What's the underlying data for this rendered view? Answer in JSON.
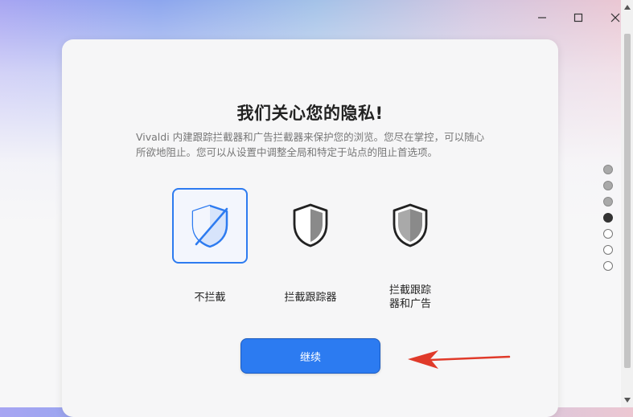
{
  "window_controls": {
    "minimize_icon": "minimize-icon",
    "maximize_icon": "maximize-icon",
    "close_icon": "close-icon"
  },
  "dialog": {
    "title": "我们关心您的隐私!",
    "description": "Vivaldi 内建跟踪拦截器和广告拦截器来保护您的浏览。您尽在掌控，可以随心所欲地阻止。您可以从设置中调整全局和特定于站点的阻止首选项。",
    "options": [
      {
        "label": "不拦截",
        "icon": "shield-off-icon",
        "selected": true
      },
      {
        "label": "拦截跟踪器",
        "icon": "shield-half-icon",
        "selected": false
      },
      {
        "label_line1": "拦截跟踪",
        "label_line2": "器和广告",
        "icon": "shield-full-icon",
        "selected": false
      }
    ],
    "continue_label": "继续"
  },
  "progress": {
    "total_steps": 7,
    "current_step": 4
  },
  "colors": {
    "accent": "#2c7bf1",
    "arrow": "#e03a2a"
  }
}
